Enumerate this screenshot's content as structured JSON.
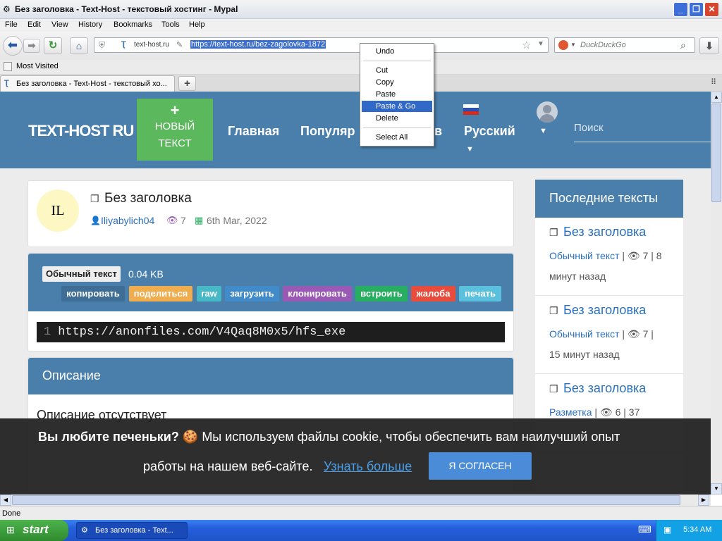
{
  "window": {
    "title": "Без заголовка - Text-Host - текстовый хостинг - Mypal"
  },
  "menu": [
    "File",
    "Edit",
    "View",
    "History",
    "Bookmarks",
    "Tools",
    "Help"
  ],
  "urlbar": {
    "site": "text-host.ru",
    "url": "https://text-host.ru/bez-zagolovka-1872"
  },
  "search": {
    "placeholder": "DuckDuckGo"
  },
  "bookmarks": {
    "most_visited": "Most Visited"
  },
  "tab": {
    "title": "Без заголовка - Text-Host - текстовый хо..."
  },
  "context_menu": {
    "undo": "Undo",
    "cut": "Cut",
    "copy": "Copy",
    "paste": "Paste",
    "paste_go": "Paste & Go",
    "delete": "Delete",
    "select_all": "Select All"
  },
  "site": {
    "logo": "TEXT-HOST RU",
    "new_text_plus": "+",
    "new_text_line1": "НОВЫЙ",
    "new_text_line2": "ТЕКСТ",
    "nav_home": "Главная",
    "nav_popular": "Популяр",
    "nav_cut": "в",
    "language": "Русский",
    "search_placeholder": "Поиск"
  },
  "paste": {
    "avatar_initials": "IL",
    "title": "Без заголовка",
    "author": "Iliyabylich04",
    "views": "7",
    "date": "6th Mar, 2022",
    "type_badge": "Обычный текст",
    "size": "0.04 KB",
    "buttons": [
      {
        "label": "копировать",
        "color": "#4a7fac"
      },
      {
        "label": "поделиться",
        "color": "#f0ad4e"
      },
      {
        "label": "raw",
        "color": "#5bc0de"
      },
      {
        "label": "загрузить",
        "color": "#428bca"
      },
      {
        "label": "клонировать",
        "color": "#9b59b6"
      },
      {
        "label": "встроить",
        "color": "#27ae60"
      },
      {
        "label": "жалоба",
        "color": "#e74c3c"
      },
      {
        "label": "печать",
        "color": "#5bc0de"
      }
    ],
    "line_number": "1",
    "code": "https://anonfiles.com/V4Qaq8M0x5/hfs_exe",
    "description_header": "Описание",
    "description_text": "Описание отсутствует"
  },
  "sidebar": {
    "header": "Последние тексты",
    "items": [
      {
        "title": "Без заголовка",
        "type": "Обычный текст",
        "meta1": "| 👁 7 | 8",
        "meta2": "минут назад"
      },
      {
        "title": "Без заголовка",
        "type": "Обычный текст",
        "meta1": "| 👁 7 |",
        "meta2": "15 минут назад"
      },
      {
        "title": "Без заголовка",
        "type": "Разметка",
        "meta1": "| 👁 6 | 37",
        "meta2": ""
      }
    ]
  },
  "cookie": {
    "text1": "Вы любите печеньки?",
    "text2": "Мы используем файлы cookie, чтобы обеспечить вам наилучший опыт",
    "text3": "работы на нашем веб-сайте.",
    "link": "Узнать больше",
    "button": "Я СОГЛАСЕН"
  },
  "status": {
    "text": "Done"
  },
  "taskbar": {
    "start": "start",
    "task": "Без заголовка - Text...",
    "clock": "5:34 AM"
  }
}
